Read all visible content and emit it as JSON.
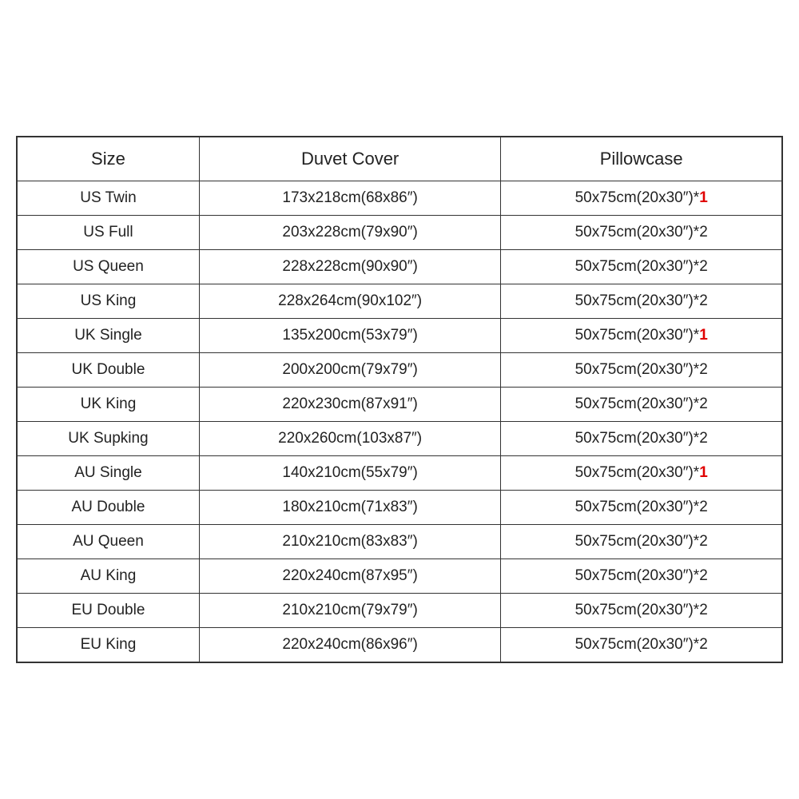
{
  "table": {
    "headers": [
      "Size",
      "Duvet Cover",
      "Pillowcase"
    ],
    "rows": [
      {
        "size": "US Twin",
        "duvet": "173x218cm(68x86″)",
        "pillowcase_base": "50x75cm(20x30″)*",
        "pillowcase_count": "1",
        "red": true
      },
      {
        "size": "US Full",
        "duvet": "203x228cm(79x90″)",
        "pillowcase_base": "50x75cm(20x30″)*",
        "pillowcase_count": "2",
        "red": false
      },
      {
        "size": "US Queen",
        "duvet": "228x228cm(90x90″)",
        "pillowcase_base": "50x75cm(20x30″)*",
        "pillowcase_count": "2",
        "red": false
      },
      {
        "size": "US King",
        "duvet": "228x264cm(90x102″)",
        "pillowcase_base": "50x75cm(20x30″)*",
        "pillowcase_count": "2",
        "red": false
      },
      {
        "size": "UK Single",
        "duvet": "135x200cm(53x79″)",
        "pillowcase_base": "50x75cm(20x30″)*",
        "pillowcase_count": "1",
        "red": true
      },
      {
        "size": "UK Double",
        "duvet": "200x200cm(79x79″)",
        "pillowcase_base": "50x75cm(20x30″)*",
        "pillowcase_count": "2",
        "red": false
      },
      {
        "size": "UK King",
        "duvet": "220x230cm(87x91″)",
        "pillowcase_base": "50x75cm(20x30″)*",
        "pillowcase_count": "2",
        "red": false
      },
      {
        "size": "UK Supking",
        "duvet": "220x260cm(103x87″)",
        "pillowcase_base": "50x75cm(20x30″)*",
        "pillowcase_count": "2",
        "red": false
      },
      {
        "size": "AU Single",
        "duvet": "140x210cm(55x79″)",
        "pillowcase_base": "50x75cm(20x30″)*",
        "pillowcase_count": "1",
        "red": true
      },
      {
        "size": "AU Double",
        "duvet": "180x210cm(71x83″)",
        "pillowcase_base": "50x75cm(20x30″)*",
        "pillowcase_count": "2",
        "red": false
      },
      {
        "size": "AU Queen",
        "duvet": "210x210cm(83x83″)",
        "pillowcase_base": "50x75cm(20x30″)*",
        "pillowcase_count": "2",
        "red": false
      },
      {
        "size": "AU King",
        "duvet": "220x240cm(87x95″)",
        "pillowcase_base": "50x75cm(20x30″)*",
        "pillowcase_count": "2",
        "red": false
      },
      {
        "size": "EU Double",
        "duvet": "210x210cm(79x79″)",
        "pillowcase_base": "50x75cm(20x30″)*",
        "pillowcase_count": "2",
        "red": false
      },
      {
        "size": "EU King",
        "duvet": "220x240cm(86x96″)",
        "pillowcase_base": "50x75cm(20x30″)*",
        "pillowcase_count": "2",
        "red": false
      }
    ]
  }
}
